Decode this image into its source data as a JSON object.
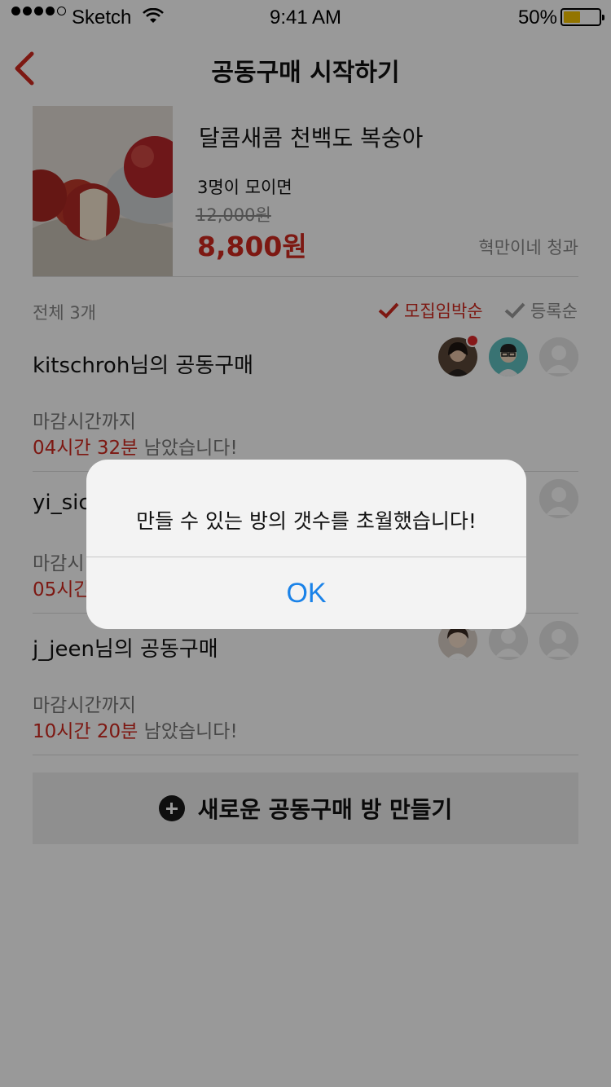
{
  "status_bar": {
    "carrier": "Sketch",
    "time": "9:41 AM",
    "battery": "50%",
    "signal_bars": 4,
    "battery_level": 0.5
  },
  "nav": {
    "title": "공동구매 시작하기",
    "back_icon": "chevron-left-icon"
  },
  "product": {
    "name": "달콤새콤 천백도 복숭아",
    "min_people": "3명이 모이면",
    "original_price": "12,000원",
    "price": "8,800원",
    "seller": "혁만이네 청과"
  },
  "list": {
    "total": "전체 3개",
    "sort_active": "모집임박순",
    "sort_inactive": "등록순"
  },
  "rooms": [
    {
      "title": "kitschroh님의 공동구매",
      "deadline_label": "마감시간까지",
      "time_left": "04시간 32분",
      "remain_suffix": " 남았습니다!"
    },
    {
      "title": "yi_sich",
      "deadline_label": "마감시",
      "time_left": "05시간",
      "remain_suffix": ""
    },
    {
      "title": "j_jeen님의 공동구매",
      "deadline_label": "마감시간까지",
      "time_left": "10시간 20분",
      "remain_suffix": " 남았습니다!"
    }
  ],
  "create_button": {
    "label": "새로운 공동구매 방 만들기",
    "icon": "plus-circle-icon"
  },
  "alert": {
    "message": "만들 수 있는 방의 갯수를 초월했습니다!",
    "ok_label": "OK"
  },
  "colors": {
    "accent": "#d0281f",
    "link": "#1a82e8",
    "dim_overlay": "rgba(0,0,0,0.40)"
  }
}
